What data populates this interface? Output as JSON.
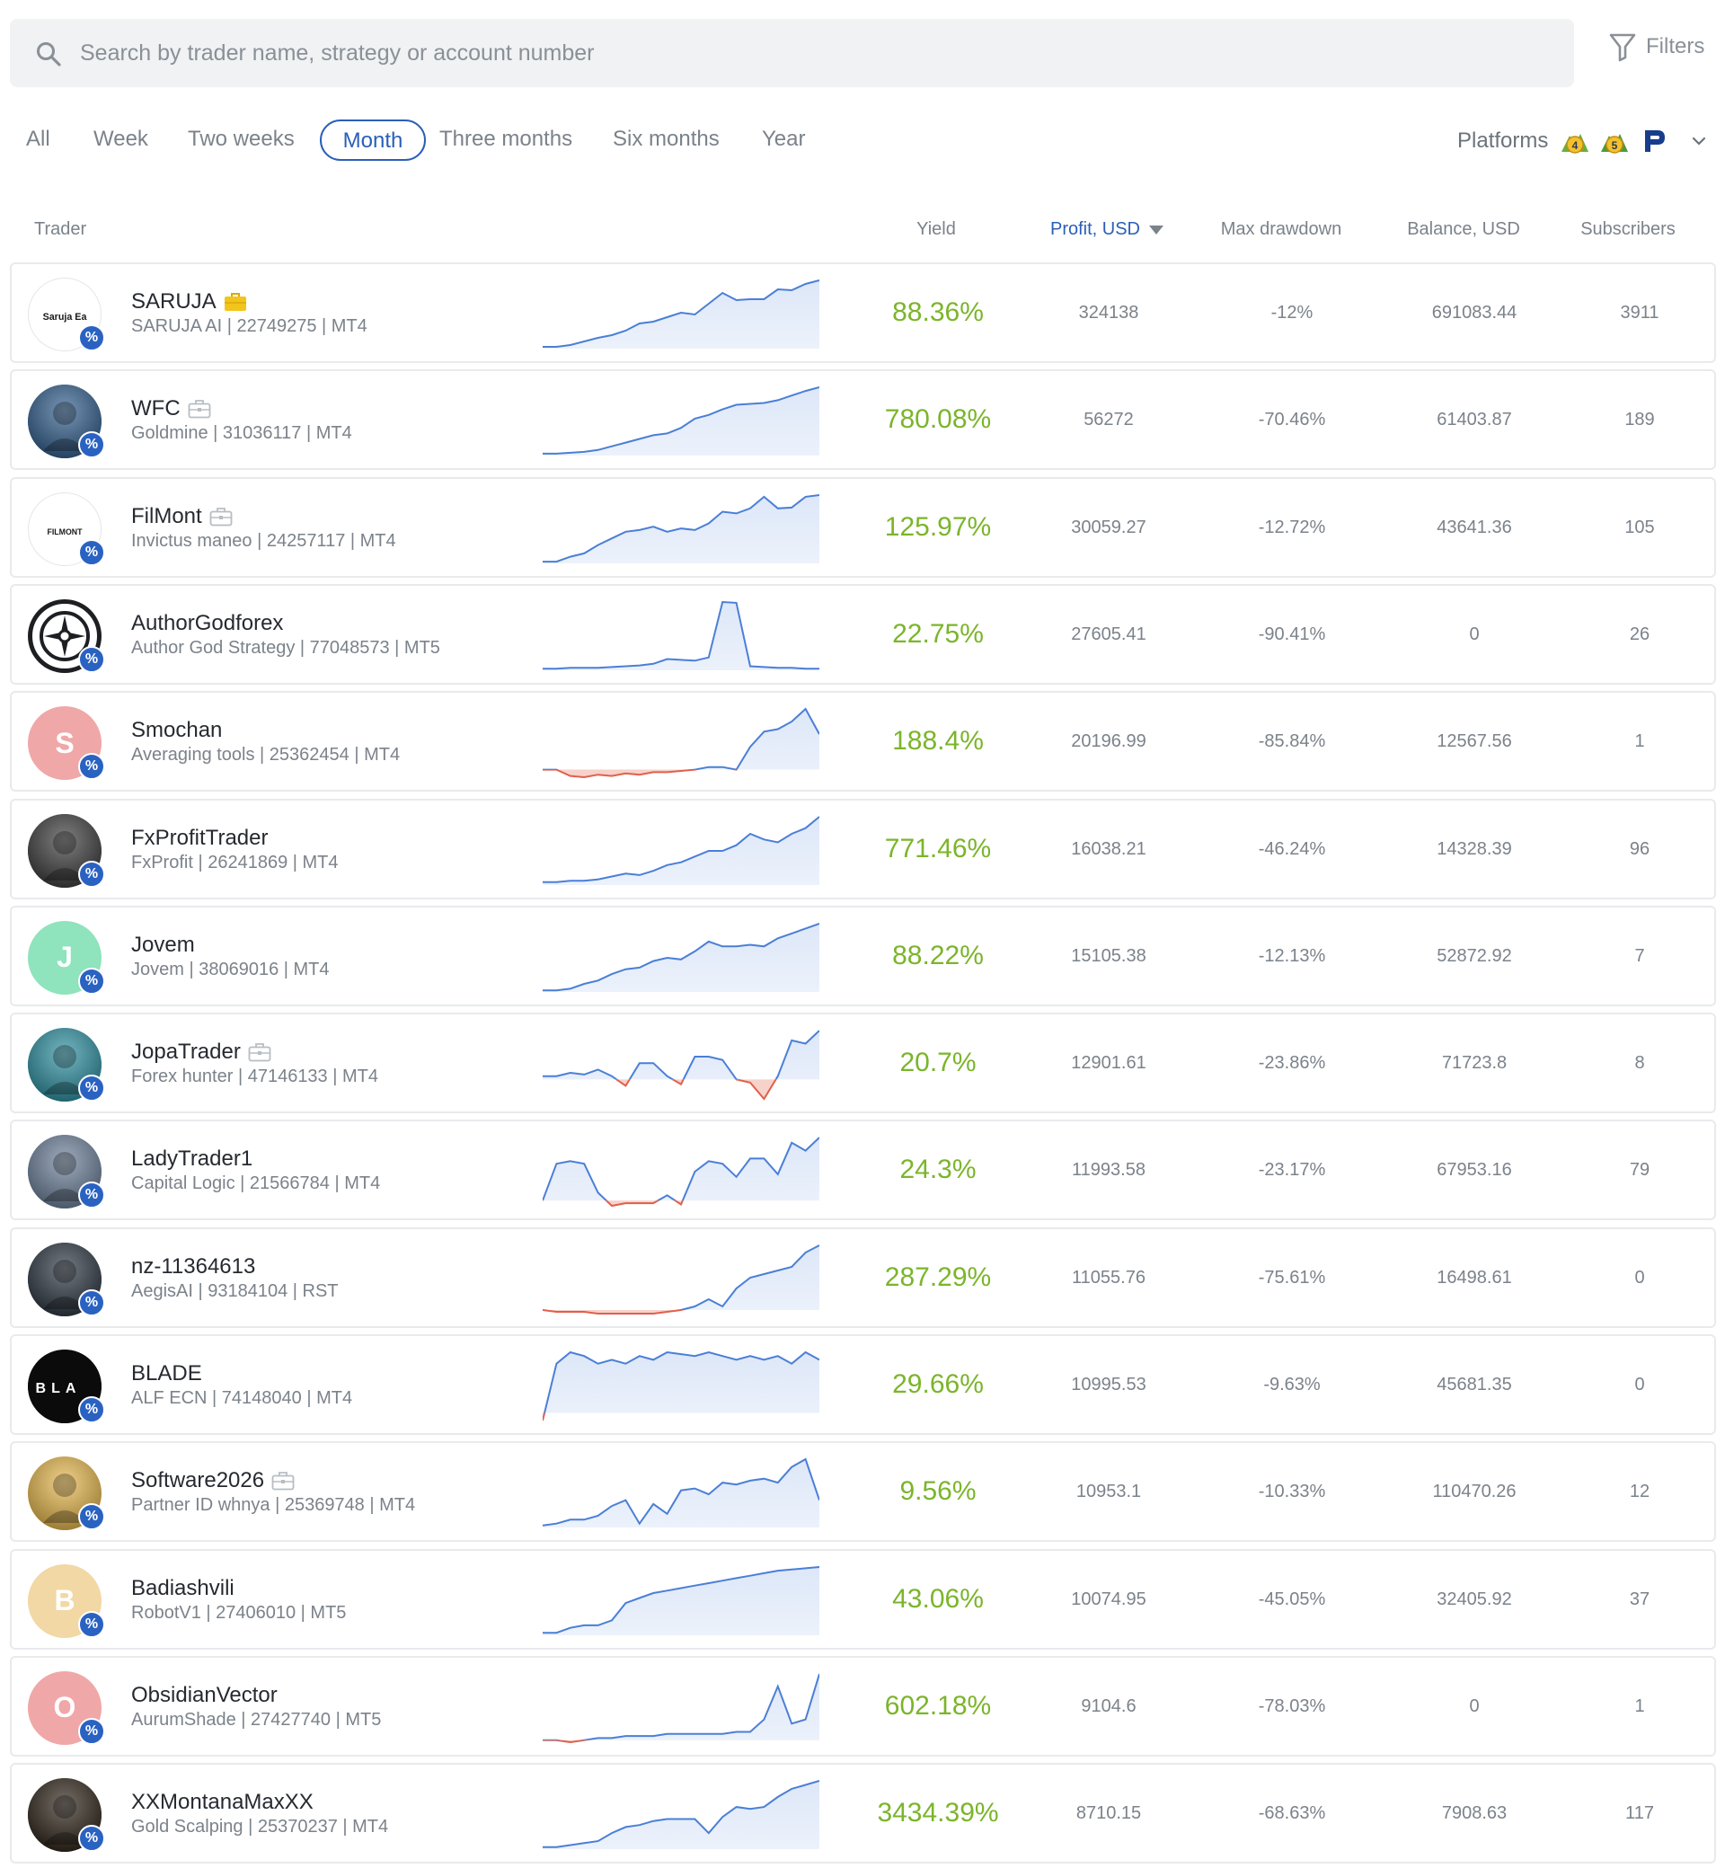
{
  "search": {
    "placeholder": "Search by trader name, strategy or account number",
    "value": ""
  },
  "filters_label": "Filters",
  "periods": [
    "All",
    "Week",
    "Two weeks",
    "Month",
    "Three months",
    "Six months",
    "Year"
  ],
  "active_period": "Month",
  "platforms": {
    "label": "Platforms",
    "icons": [
      "metatrader-4-icon",
      "metatrader-5-icon",
      "rstrader-icon"
    ]
  },
  "columns": {
    "trader": "Trader",
    "yield": "Yield",
    "profit": "Profit, USD",
    "drawdown": "Max drawdown",
    "balance": "Balance, USD",
    "subscribers": "Subscribers"
  },
  "colors": {
    "accent": "#2a5fb8",
    "yield_green": "#7bb52a",
    "spark_line_up": "#4a7fd6",
    "spark_fill_up": "#dde7f8",
    "spark_line_down": "#e0604a",
    "spark_fill_down": "#f6d2cb",
    "badge_blue": "#2a62c2",
    "case_active": "#f2c51d",
    "case_inactive": "#b8bdc2"
  },
  "traders": [
    {
      "name": "SARUJA",
      "sub": "SARUJA AI | 22749275 | MT4",
      "yield": "88.36%",
      "profit": "324138",
      "drawdown": "-12%",
      "balance": "691083.44",
      "subscribers": "3911",
      "avatar": {
        "type": "logo",
        "text": "Saruja Ea"
      },
      "case": "active",
      "spark": [
        2,
        2,
        4,
        8,
        12,
        15,
        20,
        28,
        30,
        35,
        40,
        38,
        50,
        62,
        54,
        55,
        55,
        66,
        65,
        72,
        76
      ]
    },
    {
      "name": "WFC",
      "sub": "Goldmine | 31036117 | MT4",
      "yield": "780.08%",
      "profit": "56272",
      "drawdown": "-70.46%",
      "balance": "61403.87",
      "subscribers": "189",
      "avatar": {
        "type": "photo",
        "bg": "#2f5d8c"
      },
      "case": "inactive",
      "spark": [
        2,
        2,
        3,
        4,
        6,
        10,
        14,
        18,
        22,
        24,
        30,
        40,
        44,
        50,
        55,
        56,
        57,
        60,
        65,
        70,
        74
      ]
    },
    {
      "name": "FilMont",
      "sub": "Invictus maneo | 24257117 | MT4",
      "yield": "125.97%",
      "profit": "30059.27",
      "drawdown": "-12.72%",
      "balance": "43641.36",
      "subscribers": "105",
      "avatar": {
        "type": "logo",
        "text": "FILMONT"
      },
      "case": "inactive",
      "spark": [
        2,
        2,
        8,
        12,
        22,
        30,
        38,
        40,
        44,
        38,
        42,
        40,
        48,
        62,
        60,
        66,
        80,
        66,
        67,
        80,
        82
      ]
    },
    {
      "name": "AuthorGodforex",
      "sub": "Author God Strategy | 77048573 | MT5",
      "yield": "22.75%",
      "profit": "27605.41",
      "drawdown": "-90.41%",
      "balance": "0",
      "subscribers": "26",
      "avatar": {
        "type": "emblem",
        "bg": "#1d1f22"
      },
      "case": "none",
      "spark": [
        2,
        2,
        3,
        3,
        3,
        4,
        5,
        6,
        8,
        14,
        13,
        12,
        16,
        85,
        84,
        5,
        4,
        3,
        3,
        2,
        2
      ]
    },
    {
      "name": "Smochan",
      "sub": "Averaging tools | 25362454 | MT4",
      "yield": "188.4%",
      "profit": "20196.99",
      "drawdown": "-85.84%",
      "balance": "12567.56",
      "subscribers": "1",
      "avatar": {
        "type": "initial",
        "letter": "S",
        "bg": "#f0a7a8"
      },
      "case": "none",
      "spark": [
        0,
        0,
        -5,
        -6,
        -4,
        -5,
        -3,
        -4,
        -2,
        -2,
        -1,
        0,
        2,
        2,
        0,
        18,
        30,
        32,
        38,
        48,
        28
      ]
    },
    {
      "name": "FxProfitTrader",
      "sub": "FxProfit | 26241869 | MT4",
      "yield": "771.46%",
      "profit": "16038.21",
      "drawdown": "-46.24%",
      "balance": "14328.39",
      "subscribers": "96",
      "avatar": {
        "type": "photo",
        "bg": "#3a3a3a"
      },
      "case": "none",
      "spark": [
        2,
        2,
        3,
        3,
        4,
        6,
        8,
        7,
        10,
        14,
        16,
        20,
        24,
        24,
        28,
        36,
        32,
        30,
        36,
        40,
        48
      ]
    },
    {
      "name": "Jovem",
      "sub": "Jovem | 38069016 | MT4",
      "yield": "88.22%",
      "profit": "15105.38",
      "drawdown": "-12.13%",
      "balance": "52872.92",
      "subscribers": "7",
      "avatar": {
        "type": "initial",
        "letter": "J",
        "bg": "#8fe3bd"
      },
      "case": "none",
      "spark": [
        2,
        2,
        4,
        10,
        14,
        22,
        28,
        30,
        38,
        42,
        40,
        50,
        62,
        56,
        56,
        58,
        56,
        66,
        72,
        78,
        84
      ]
    },
    {
      "name": "JopaTrader",
      "sub": "Forex hunter | 47146133 | MT4",
      "yield": "20.7%",
      "profit": "12901.61",
      "drawdown": "-23.86%",
      "balance": "71723.8",
      "subscribers": "8",
      "avatar": {
        "type": "photo",
        "bg": "#2a8fa0"
      },
      "case": "inactive",
      "spark": [
        2,
        2,
        4,
        3,
        6,
        2,
        -4,
        10,
        10,
        2,
        -3,
        14,
        14,
        12,
        0,
        -2,
        -12,
        2,
        24,
        22,
        30
      ]
    },
    {
      "name": "LadyTrader1",
      "sub": "Capital Logic | 21566784 | MT4",
      "yield": "24.3%",
      "profit": "11993.58",
      "drawdown": "-23.17%",
      "balance": "67953.16",
      "subscribers": "79",
      "avatar": {
        "type": "photo",
        "bg": "#6b7f9a"
      },
      "case": "none",
      "spark": [
        0,
        28,
        30,
        28,
        6,
        -4,
        -2,
        -2,
        -2,
        4,
        -3,
        22,
        30,
        28,
        18,
        32,
        32,
        20,
        44,
        38,
        48
      ]
    },
    {
      "name": "nz-11364613",
      "sub": "AegisAI | 93184104 | RST",
      "yield": "287.29%",
      "profit": "11055.76",
      "drawdown": "-75.61%",
      "balance": "16498.61",
      "subscribers": "0",
      "avatar": {
        "type": "photo",
        "bg": "#2a3440"
      },
      "case": "none",
      "spark": [
        0,
        -1,
        -1,
        -1,
        -2,
        -2,
        -2,
        -2,
        -2,
        -1,
        0,
        2,
        6,
        2,
        12,
        18,
        20,
        22,
        24,
        32,
        36
      ]
    },
    {
      "name": "BLADE",
      "sub": "ALF ECN | 74148040 | MT4",
      "yield": "29.66%",
      "profit": "10995.53",
      "drawdown": "-9.63%",
      "balance": "45681.35",
      "subscribers": "0",
      "avatar": {
        "type": "logo-dark",
        "text": "BLA",
        "bg": "#0b0b0c"
      },
      "case": "none",
      "spark": [
        -4,
        26,
        32,
        30,
        26,
        28,
        26,
        30,
        28,
        32,
        31,
        30,
        32,
        30,
        28,
        30,
        28,
        30,
        26,
        32,
        28
      ]
    },
    {
      "name": "Software2026",
      "sub": "Partner ID whnya | 25369748 | MT4",
      "yield": "9.56%",
      "profit": "10953.1",
      "drawdown": "-10.33%",
      "balance": "110470.26",
      "subscribers": "12",
      "avatar": {
        "type": "photo",
        "bg": "#e8b84a"
      },
      "case": "inactive",
      "spark": [
        2,
        4,
        8,
        8,
        12,
        22,
        28,
        4,
        24,
        14,
        38,
        40,
        34,
        46,
        44,
        48,
        50,
        46,
        62,
        70,
        28
      ]
    },
    {
      "name": "Badiashvili",
      "sub": "RobotV1 | 27406010 | MT5",
      "yield": "43.06%",
      "profit": "10074.95",
      "drawdown": "-45.05%",
      "balance": "32405.92",
      "subscribers": "37",
      "avatar": {
        "type": "initial",
        "letter": "B",
        "bg": "#f1d8a4"
      },
      "case": "none",
      "spark": [
        2,
        2,
        6,
        8,
        8,
        12,
        26,
        30,
        34,
        36,
        38,
        40,
        42,
        44,
        46,
        48,
        50,
        52,
        53,
        54,
        55
      ]
    },
    {
      "name": "ObsidianVector",
      "sub": "AurumShade | 27427740 | MT5",
      "yield": "602.18%",
      "profit": "9104.6",
      "drawdown": "-78.03%",
      "balance": "0",
      "subscribers": "1",
      "avatar": {
        "type": "initial",
        "letter": "O",
        "bg": "#f0a7a8"
      },
      "case": "none",
      "spark": [
        0,
        0,
        -1,
        0,
        1,
        1,
        2,
        2,
        2,
        3,
        3,
        3,
        3,
        3,
        4,
        4,
        10,
        26,
        8,
        10,
        32
      ]
    },
    {
      "name": "XXMontanaMaxXX",
      "sub": "Gold Scalping | 25370237 | MT4",
      "yield": "3434.39%",
      "profit": "8710.15",
      "drawdown": "-68.63%",
      "balance": "7908.63",
      "subscribers": "117",
      "avatar": {
        "type": "photo",
        "bg": "#2b2116"
      },
      "case": "none",
      "spark": [
        2,
        2,
        4,
        6,
        8,
        16,
        22,
        24,
        28,
        30,
        30,
        30,
        16,
        32,
        42,
        40,
        42,
        52,
        60,
        64,
        68
      ]
    }
  ]
}
